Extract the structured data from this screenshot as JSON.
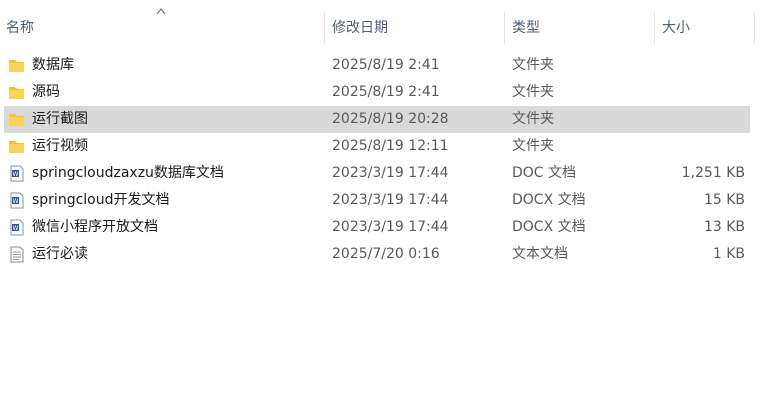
{
  "columns": {
    "name": "名称",
    "date": "修改日期",
    "type": "类型",
    "size": "大小"
  },
  "files": [
    {
      "name": "数据库",
      "date": "2025/8/19 2:41",
      "type": "文件夹",
      "size": "",
      "icon": "folder-icon"
    },
    {
      "name": "源码",
      "date": "2025/8/19 2:41",
      "type": "文件夹",
      "size": "",
      "icon": "folder-icon"
    },
    {
      "name": "运行截图",
      "date": "2025/8/19 20:28",
      "type": "文件夹",
      "size": "",
      "icon": "folder-icon",
      "selected": true
    },
    {
      "name": "运行视频",
      "date": "2025/8/19 12:11",
      "type": "文件夹",
      "size": "",
      "icon": "folder-icon"
    },
    {
      "name": "springcloudzaxzu数据库文档",
      "date": "2023/3/19 17:44",
      "type": "DOC 文档",
      "size": "1,251 KB",
      "icon": "word-doc-icon"
    },
    {
      "name": "springcloud开发文档",
      "date": "2023/3/19 17:44",
      "type": "DOCX 文档",
      "size": "15 KB",
      "icon": "word-docx-icon"
    },
    {
      "name": "微信小程序开放文档",
      "date": "2023/3/19 17:44",
      "type": "DOCX 文档",
      "size": "13 KB",
      "icon": "word-docx-icon"
    },
    {
      "name": "运行必读",
      "date": "2025/7/20 0:16",
      "type": "文本文档",
      "size": "1 KB",
      "icon": "text-file-icon"
    }
  ],
  "colors": {
    "header_text": "#4c607a",
    "selected_row": "#d9d9d9",
    "folder": "#f2c230"
  }
}
